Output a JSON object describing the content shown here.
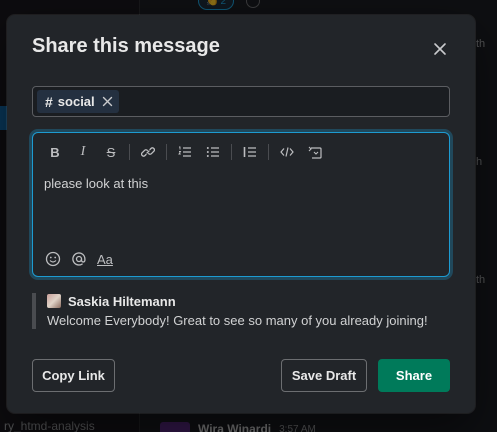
{
  "background": {
    "reaction_count": "2",
    "sidebar_lines": [
      "ry_htmd-analysis"
    ],
    "right_fragments": [
      "th",
      "h",
      "th"
    ],
    "bottom_message": {
      "user": "Wira Winardi",
      "time": "3:57 AM"
    }
  },
  "modal": {
    "title": "Share this message",
    "close_icon": "close-icon",
    "channel_chip": {
      "hash": "#",
      "name": "social"
    },
    "composer": {
      "text": "please look at this",
      "toolbar_icons": [
        "bold-icon",
        "italic-icon",
        "strikethrough-icon",
        "link-icon",
        "ordered-list-icon",
        "bulleted-list-icon",
        "blockquote-icon",
        "code-icon",
        "code-block-icon"
      ],
      "toolbar_glyphs": {
        "bold": "B",
        "italic": "I",
        "strike": "S"
      },
      "format_label": "Aa"
    },
    "quote": {
      "author": "Saskia Hiltemann",
      "text": "Welcome Everybody! Great to see so many of you already joining!"
    },
    "buttons": {
      "copy_link": "Copy Link",
      "save_draft": "Save Draft",
      "share": "Share"
    }
  },
  "colors": {
    "accent_focus": "#1d9bd1",
    "share_button": "#007a5a",
    "modal_bg": "#222529"
  }
}
